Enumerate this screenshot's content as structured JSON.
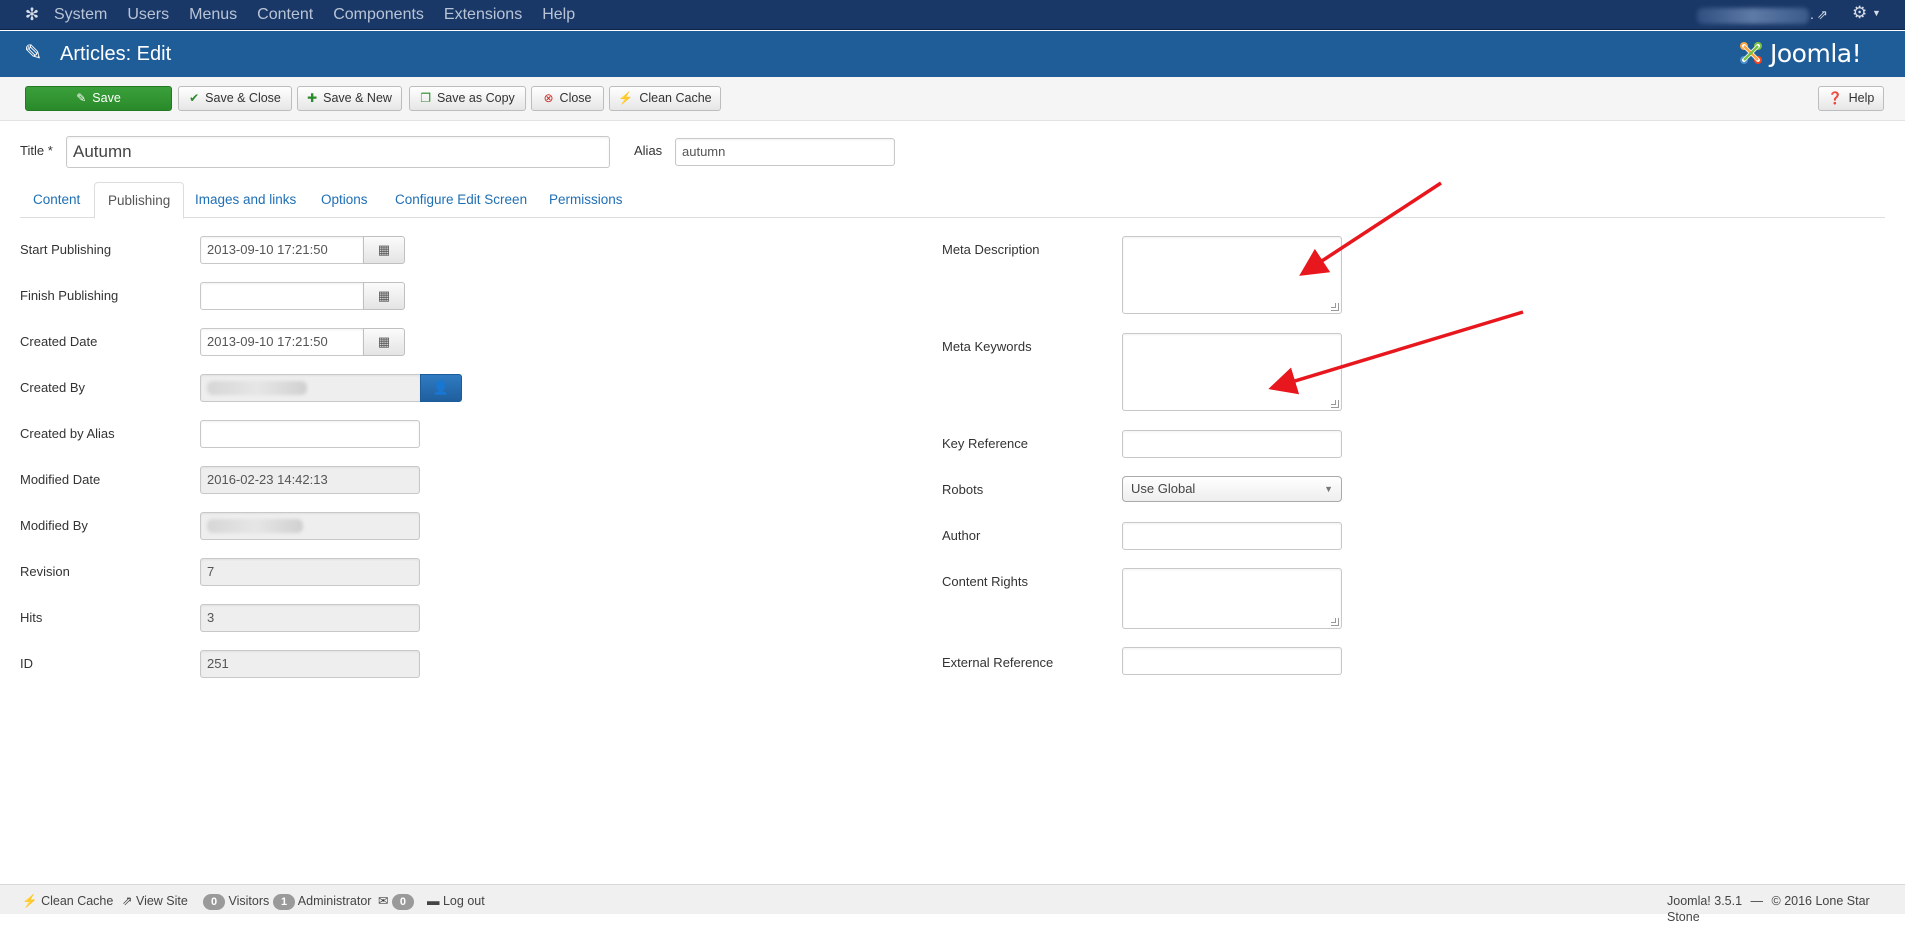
{
  "topnav": {
    "menu": [
      "System",
      "Users",
      "Menus",
      "Content",
      "Components",
      "Extensions",
      "Help"
    ]
  },
  "header": {
    "title": "Articles: Edit",
    "brand": "Joomla!"
  },
  "toolbar": {
    "save": "Save",
    "save_close": "Save & Close",
    "save_new": "Save & New",
    "save_copy": "Save as Copy",
    "close": "Close",
    "clean_cache": "Clean Cache",
    "help": "Help"
  },
  "form": {
    "title_label": "Title *",
    "title_value": "Autumn",
    "alias_label": "Alias",
    "alias_value": "autumn"
  },
  "tabs": [
    "Content",
    "Publishing",
    "Images and links",
    "Options",
    "Configure Edit Screen",
    "Permissions"
  ],
  "publishing": {
    "start_publishing": {
      "label": "Start Publishing",
      "value": "2013-09-10 17:21:50"
    },
    "finish_publishing": {
      "label": "Finish Publishing",
      "value": ""
    },
    "created_date": {
      "label": "Created Date",
      "value": "2013-09-10 17:21:50"
    },
    "created_by": {
      "label": "Created By"
    },
    "created_by_alias": {
      "label": "Created by Alias",
      "value": ""
    },
    "modified_date": {
      "label": "Modified Date",
      "value": "2016-02-23 14:42:13"
    },
    "modified_by": {
      "label": "Modified By"
    },
    "revision": {
      "label": "Revision",
      "value": "7"
    },
    "hits": {
      "label": "Hits",
      "value": "3"
    },
    "id": {
      "label": "ID",
      "value": "251"
    }
  },
  "metadata": {
    "meta_description": {
      "label": "Meta Description"
    },
    "meta_keywords": {
      "label": "Meta Keywords"
    },
    "key_reference": {
      "label": "Key Reference"
    },
    "robots": {
      "label": "Robots",
      "value": "Use Global"
    },
    "author": {
      "label": "Author"
    },
    "content_rights": {
      "label": "Content Rights"
    },
    "external_reference": {
      "label": "External Reference"
    }
  },
  "footer": {
    "clean_cache": "Clean Cache",
    "view_site": "View Site",
    "visitors_count": "0",
    "visitors": "Visitors",
    "admin_count": "1",
    "administrator": "Administrator",
    "messages_count": "0",
    "logout": "Log out",
    "version": "Joomla! 3.5.1",
    "dash": "—",
    "copyright": "© 2016 Lone Star Stone"
  },
  "colors": {
    "topnav": "#1a3867",
    "header": "#1f5d99",
    "save_green": "#2f952f",
    "link_blue": "#1f6fb5",
    "arrow_red": "#e8171d"
  }
}
